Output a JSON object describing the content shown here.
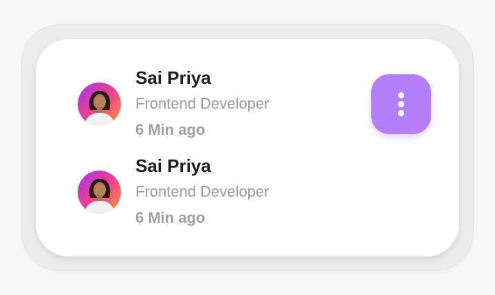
{
  "colors": {
    "page_background": "#f7f7f7",
    "card_background": "#ffffff",
    "menu_button": "#b27ff8",
    "name_text": "#1f1f1f",
    "secondary_text": "#9a9a9a"
  },
  "entries": [
    {
      "name": "Sai Priya",
      "role": "Frontend Developer",
      "time": "6 Min ago",
      "avatar_icon": "user-avatar-icon"
    },
    {
      "name": "Sai Priya",
      "role": "Frontend Developer",
      "time": "6 Min ago",
      "avatar_icon": "user-avatar-icon"
    }
  ],
  "menu_button": {
    "icon": "more-vertical-icon"
  }
}
